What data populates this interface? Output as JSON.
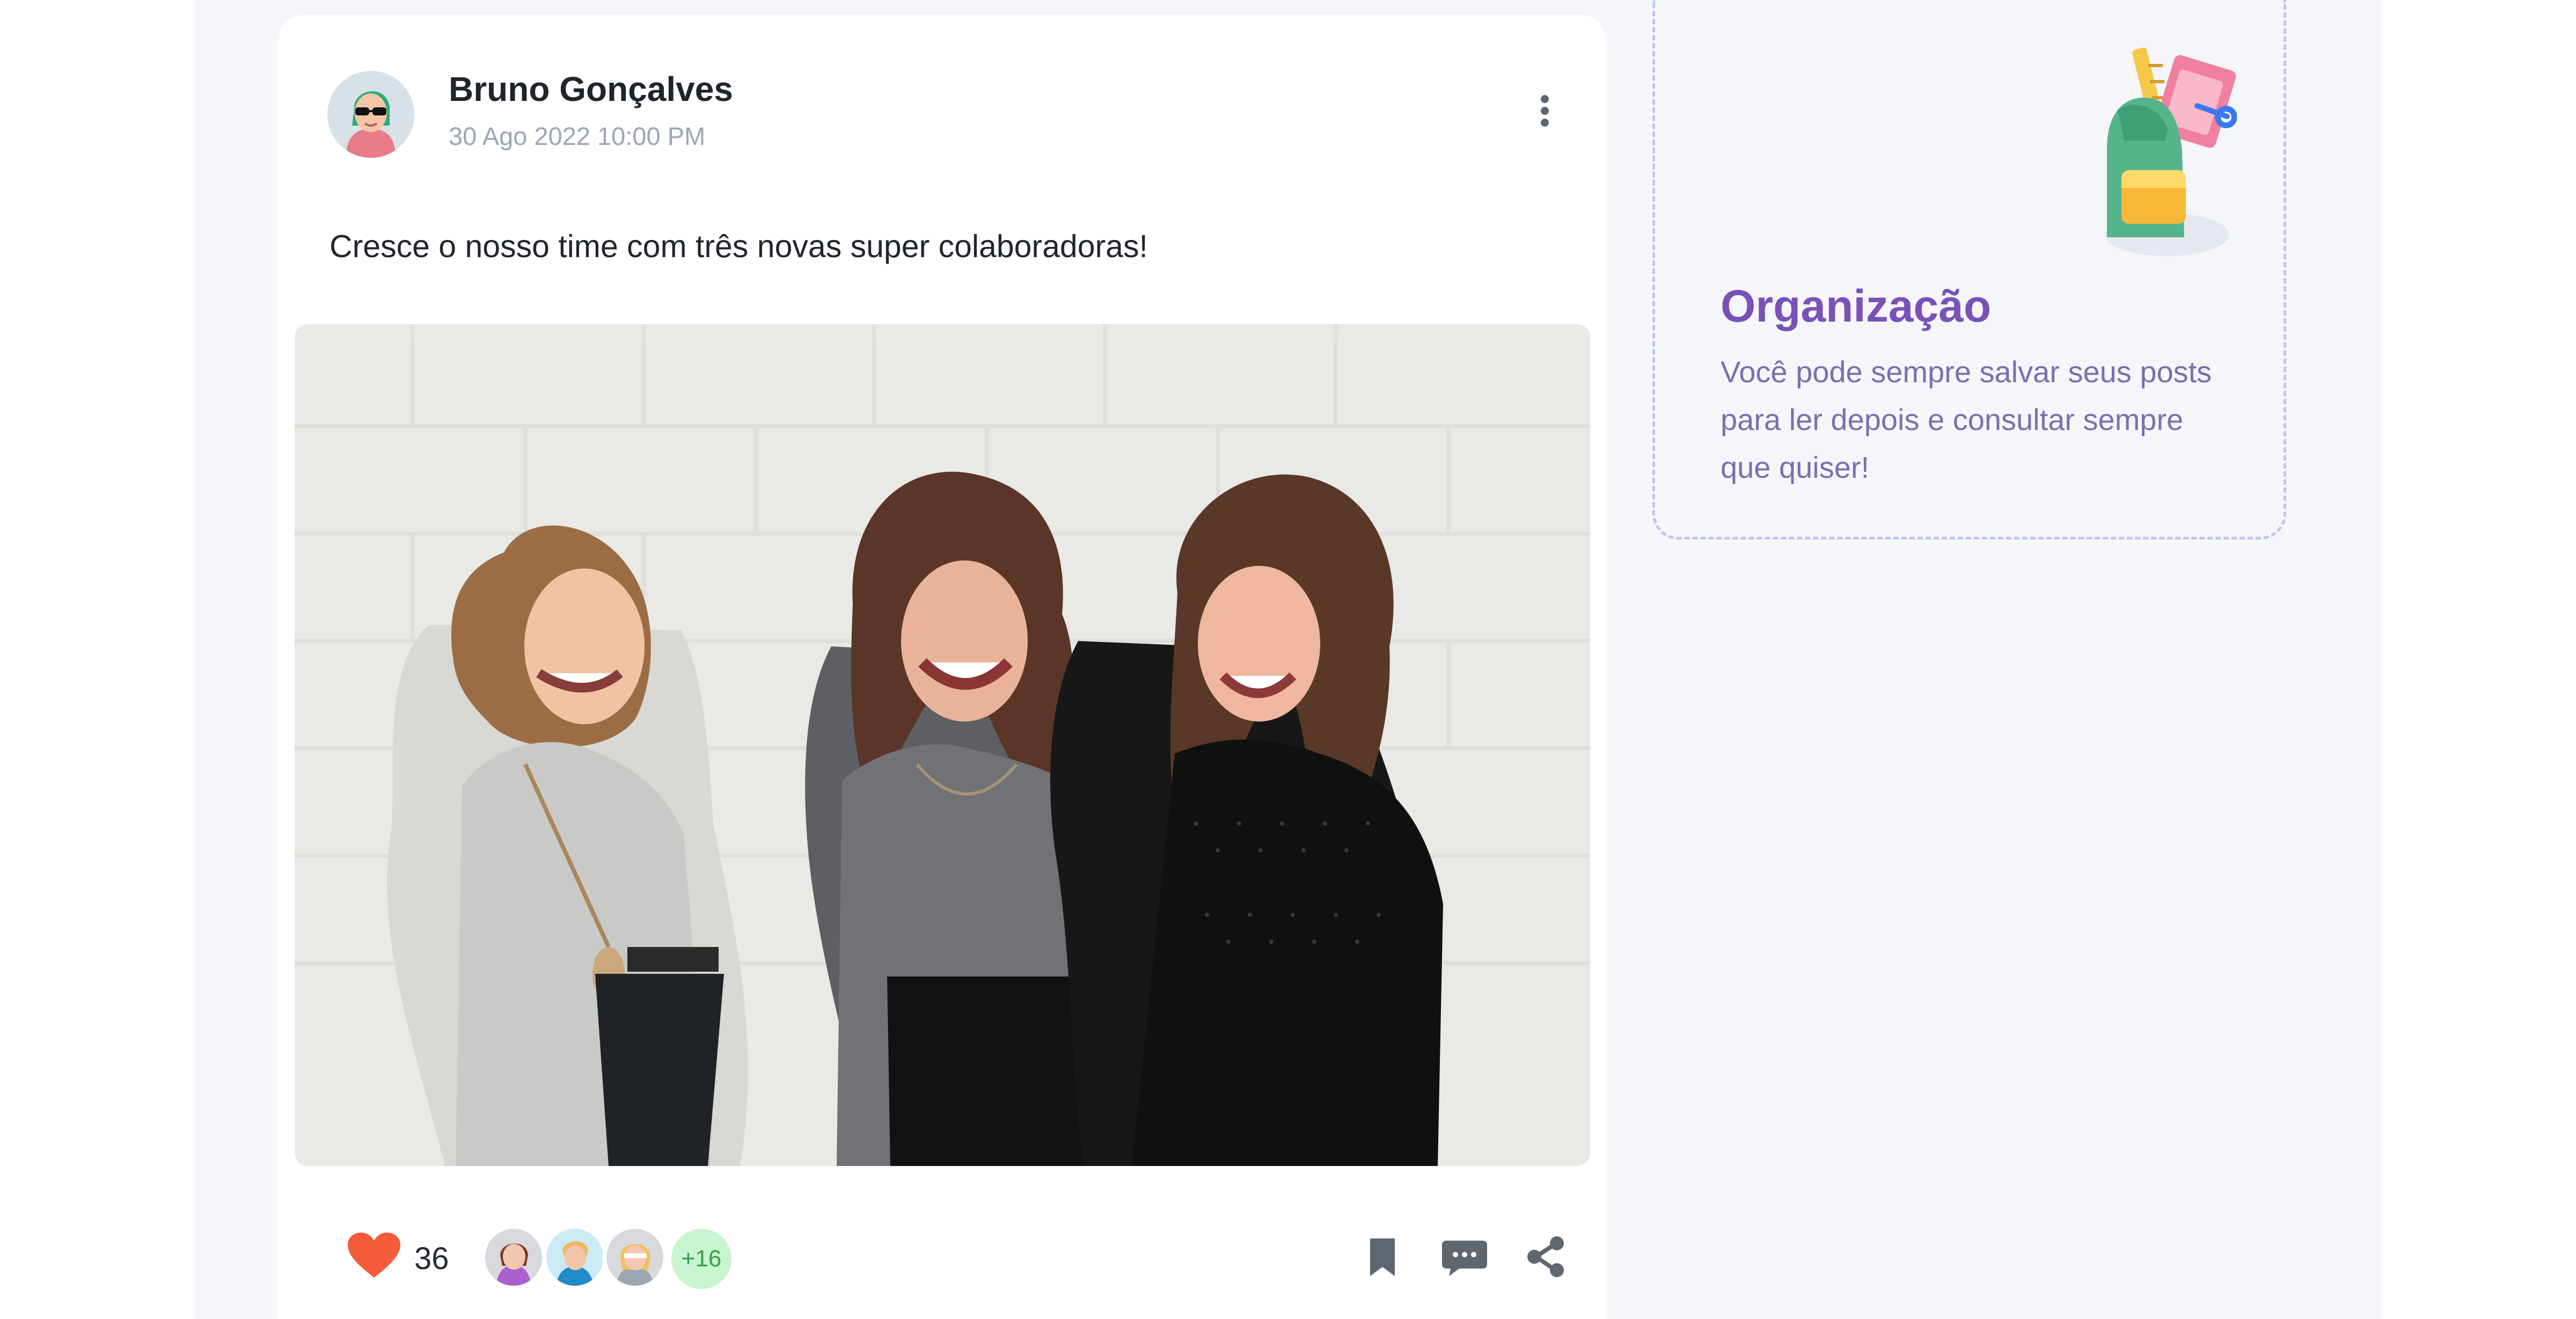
{
  "post": {
    "author_name": "Bruno Gonçalves",
    "date": "30 Ago 2022 10:00 PM",
    "text": "Cresce o nosso time com três novas super colaboradoras!",
    "likes": "36",
    "extra_reactors": "+16",
    "menu_icon": "more-vertical-icon",
    "like_icon": "heart-icon",
    "save_icon": "bookmark-icon",
    "comment_icon": "comment-icon",
    "share_icon": "share-icon"
  },
  "sidebar_card": {
    "title": "Organização",
    "description": "Você pode sempre salvar seus posts para ler depois e consultar sempre que quiser!",
    "illustration_icon": "backpack-icon"
  },
  "colors": {
    "accent_purple": "#7852b8",
    "heart_red": "#f35b3b",
    "avatar_counter_green": "#c8f4cf"
  }
}
